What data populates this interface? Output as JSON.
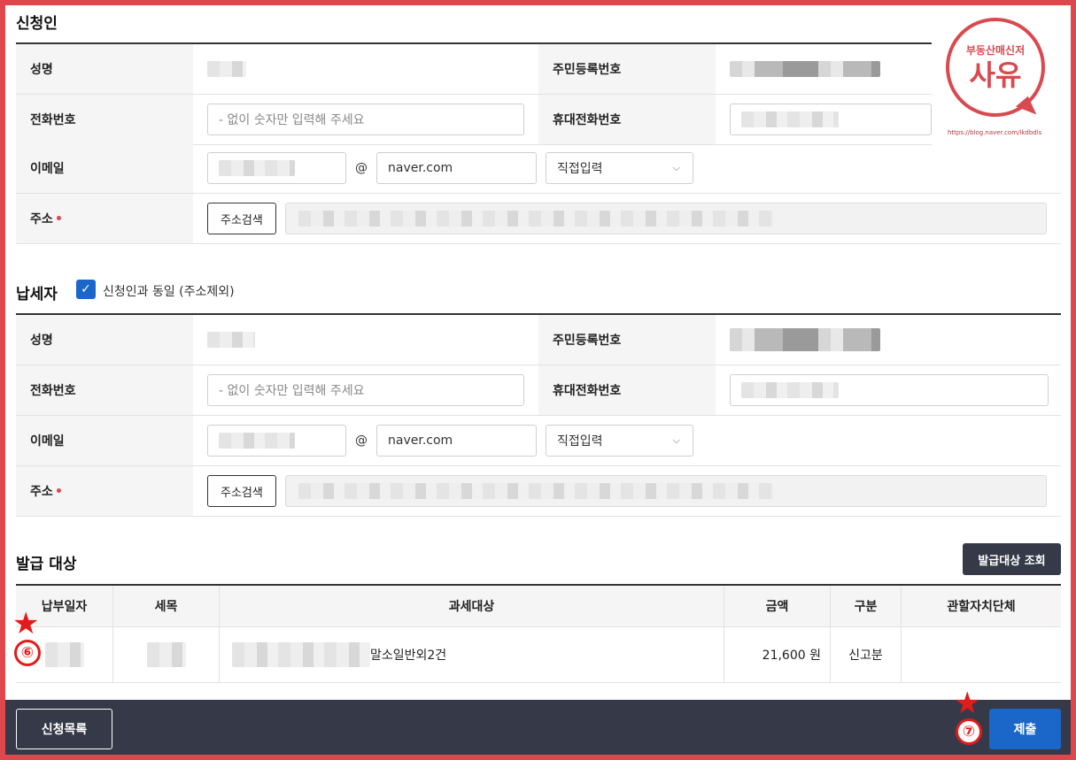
{
  "applicant": {
    "title": "신청인",
    "name_label": "성명",
    "rrn_label": "주민등록번호",
    "phone_label": "전화번호",
    "phone_placeholder": "- 없이 숫자만 입력해 주세요",
    "mobile_label": "휴대전화번호",
    "email_label": "이메일",
    "email_at": "@",
    "email_domain": "naver.com",
    "email_select": "직접입력",
    "address_label": "주소",
    "address_search": "주소검색"
  },
  "taxpayer": {
    "title": "납세자",
    "same_checkbox_label": "신청인과 동일 (주소제외)",
    "same_checked": true,
    "name_label": "성명",
    "rrn_label": "주민등록번호",
    "phone_label": "전화번호",
    "phone_placeholder": "- 없이 숫자만 입력해 주세요",
    "mobile_label": "휴대전화번호",
    "email_label": "이메일",
    "email_at": "@",
    "email_domain": "naver.com",
    "email_select": "직접입력",
    "address_label": "주소",
    "address_search": "주소검색"
  },
  "issue": {
    "title": "발급 대상",
    "lookup_button": "발급대상 조회",
    "columns": [
      "납부일자",
      "세목",
      "과세대상",
      "금액",
      "구분",
      "관할자치단체"
    ],
    "row": {
      "date": "",
      "tax_item": "",
      "target_suffix": "말소일반외2건",
      "amount": "21,600 원",
      "category": "신고분",
      "authority": ""
    }
  },
  "footer": {
    "list_button": "신청목록",
    "submit_button": "제출"
  },
  "annotations": {
    "marker_6": "⑥",
    "marker_7": "⑦"
  },
  "watermark": {
    "top": "부동산매신저",
    "main": "사유",
    "url": "https://blog.naver.com/lkdbdls"
  },
  "colors": {
    "accent_blue": "#1b66c9",
    "dark_bar": "#363a48",
    "frame_red": "#e0474c",
    "required_dot": "#e0474c"
  }
}
